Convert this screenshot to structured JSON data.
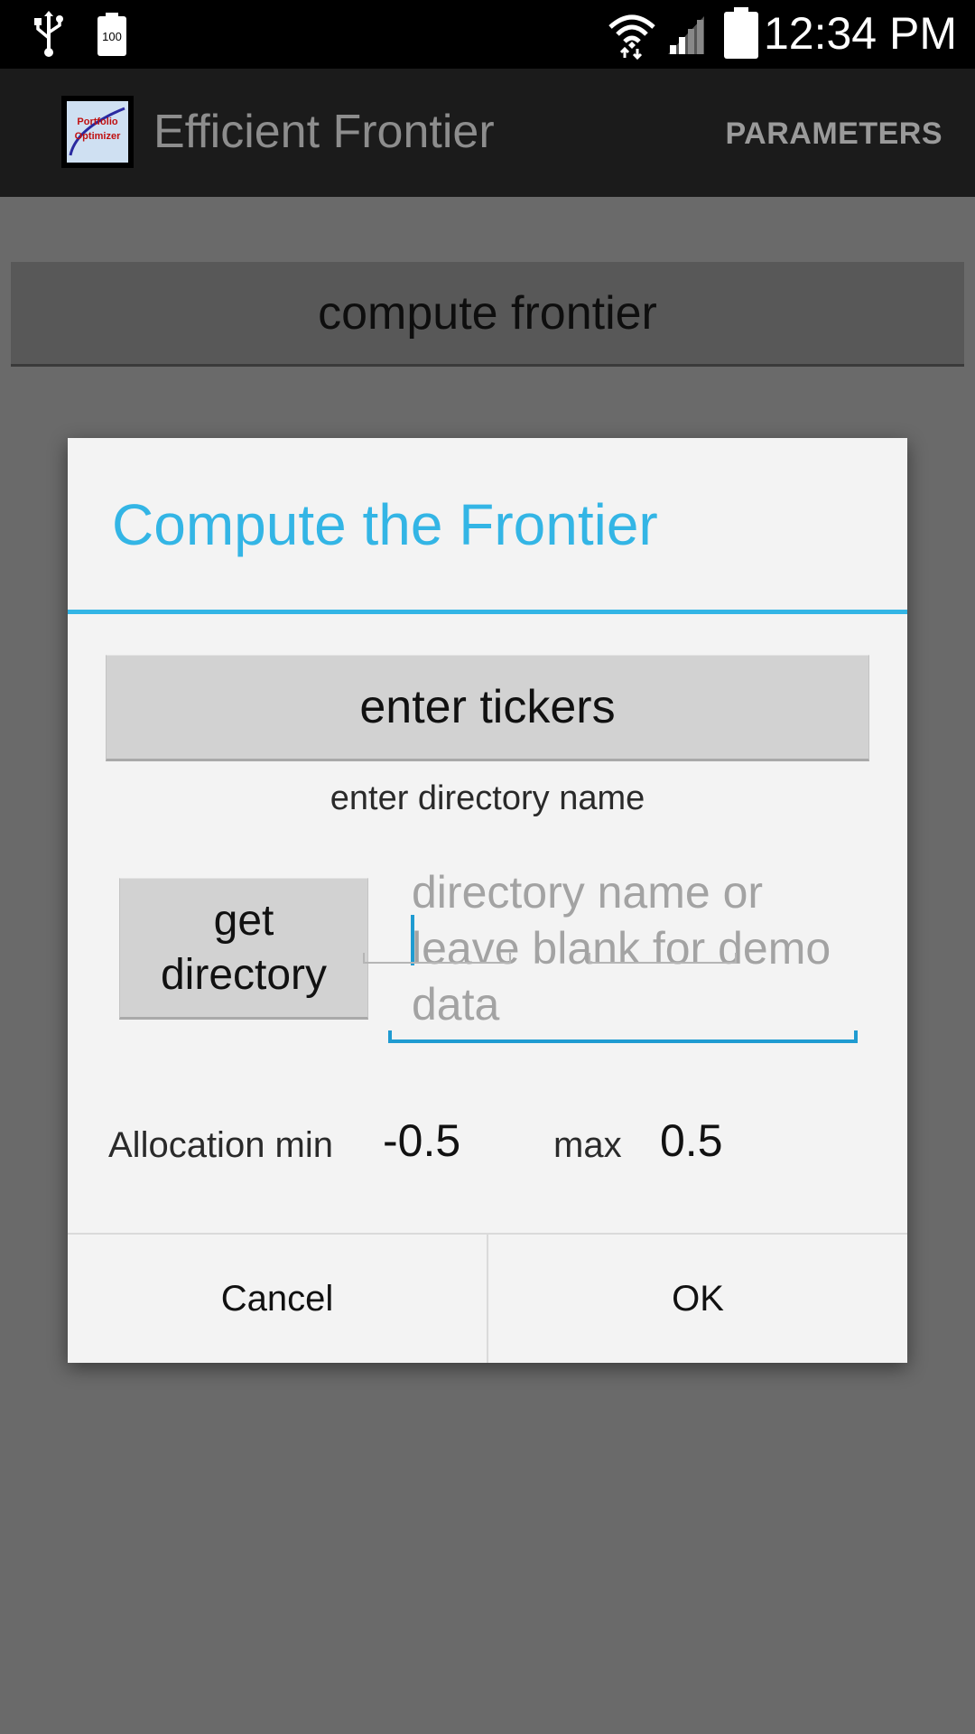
{
  "status_bar": {
    "time": "12:34 PM",
    "battery_small_label": "100"
  },
  "action_bar": {
    "title": "Efficient Frontier",
    "params_label": "PARAMETERS",
    "app_icon_text_1": "Portfolio",
    "app_icon_text_2": "Optimizer"
  },
  "main": {
    "compute_button_label": "compute frontier"
  },
  "dialog": {
    "title": "Compute the Frontier",
    "enter_tickers_label": "enter tickers",
    "directory_label": "enter directory name",
    "get_directory_label_1": "get",
    "get_directory_label_2": "directory",
    "directory_input_placeholder": "directory name or leave blank for demo data",
    "directory_input_value": "",
    "allocation_min_label": "Allocation min",
    "allocation_min_value": "-0.5",
    "allocation_max_label": "max",
    "allocation_max_value": "0.5",
    "cancel_label": "Cancel",
    "ok_label": "OK"
  },
  "colors": {
    "accent": "#33b5e5",
    "input_focus": "#1f9bd1",
    "dim_background": "#6a6a6a"
  }
}
